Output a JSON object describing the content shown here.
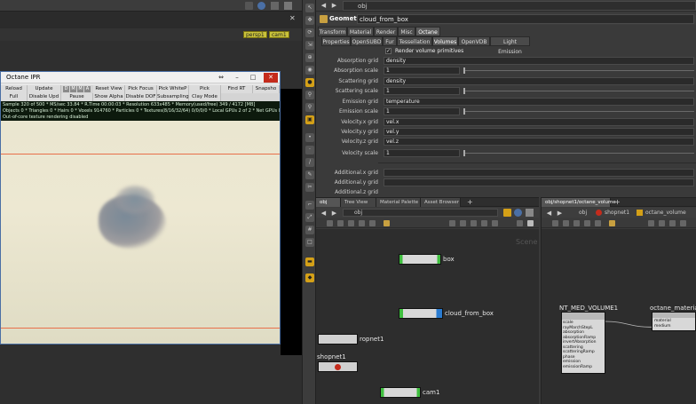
{
  "viewport": {
    "chips": [
      "persp1",
      "cam1"
    ]
  },
  "ipr": {
    "title": "Octane IPR",
    "buttons_row1": [
      "Reload",
      "Update",
      "Reset View",
      "Pick Focus",
      "Pick WhiteP",
      "Pick Material",
      "Find RT",
      "Snapsho"
    ],
    "letters": [
      "D",
      "M",
      "M",
      "A"
    ],
    "buttons_row2": [
      "Full Reload",
      "Disable Upd",
      "Pause",
      "Show Alpha",
      "Disable DOF",
      "Subsampling",
      "Clay Mode"
    ],
    "status_lines": [
      "Sample 320 of 500 * MS/sec 33.84 * R.Time 00:00:03 * Resolution 633x485 * Memory(used/free) 349 / 4172 [MB]",
      "Objects 0 * Triangles 0 * Hairs 0 * Voxels 914760 * Particles 0 * Textures(8/16/32/64) 0/0/0/0 * Local GPUs 2 of 2 * Net GPUs 0 of 0",
      "Out-of-core texture rendering disabled"
    ]
  },
  "params": {
    "path": "obj",
    "node_type": "Geometry",
    "node_name": "cloud_from_box",
    "tabs_main": [
      "Transform",
      "Material",
      "Render",
      "Misc",
      "Octane"
    ],
    "tabs_sub": [
      "Properties",
      "OpenSUBD",
      "Fur",
      "Tessellation",
      "Volumes",
      "OpenVDB",
      "Light Emission"
    ],
    "active_sub_tab": "Volumes",
    "render_volume_label": "Render volume primitives",
    "render_volume_checked": "✓",
    "rows": [
      {
        "label": "Absorption grid",
        "value": "density",
        "kind": "str"
      },
      {
        "label": "Absorption scale",
        "value": "1",
        "kind": "num"
      },
      {
        "label": "Scattering grid",
        "value": "density",
        "kind": "str"
      },
      {
        "label": "Scattering scale",
        "value": "1",
        "kind": "num"
      },
      {
        "label": "Emission grid",
        "value": "temperature",
        "kind": "str"
      },
      {
        "label": "Emission scale",
        "value": "1",
        "kind": "num"
      },
      {
        "label": "Velocity.x grid",
        "value": "vel.x",
        "kind": "str"
      },
      {
        "label": "Velocity.y grid",
        "value": "vel.y",
        "kind": "str"
      },
      {
        "label": "Velocity.z grid",
        "value": "vel.z",
        "kind": "str"
      },
      {
        "label": "Velocity scale",
        "value": "1",
        "kind": "num"
      }
    ],
    "extra_rows": [
      "Additional.x grid",
      "Additional.y grid",
      "Additional.z grid"
    ]
  },
  "net_left": {
    "tabs": [
      "obj",
      "Tree View",
      "Material Palette",
      "Asset Browser"
    ],
    "path": "obj",
    "watermark": "Scene",
    "nodes": [
      {
        "name": "box",
        "color": "#3fbf3f"
      },
      {
        "name": "cloud_from_box",
        "color": "#2a7bd0"
      },
      {
        "name": "ropnet1",
        "color": "#c8c8c8"
      },
      {
        "name": "shopnet1",
        "color": "#c8c8c8"
      },
      {
        "name": "cam1",
        "color": "#3fbf3f"
      }
    ]
  },
  "net_right": {
    "tab": "obj/shopnet1/octane_volume",
    "path_a": "obj",
    "path_b": "shopnet1",
    "path_c": "octane_volume",
    "nodes": [
      "NT_MED_VOLUME1",
      "octane_materia"
    ],
    "inputs": [
      "scale",
      "rayMarchStepL",
      "absorption",
      "absorptionRamp",
      "invertAbsorption",
      "scattering",
      "scatteringRamp",
      "phase",
      "emission",
      "emissionRamp"
    ],
    "outputs": [
      "material",
      "medium"
    ]
  }
}
